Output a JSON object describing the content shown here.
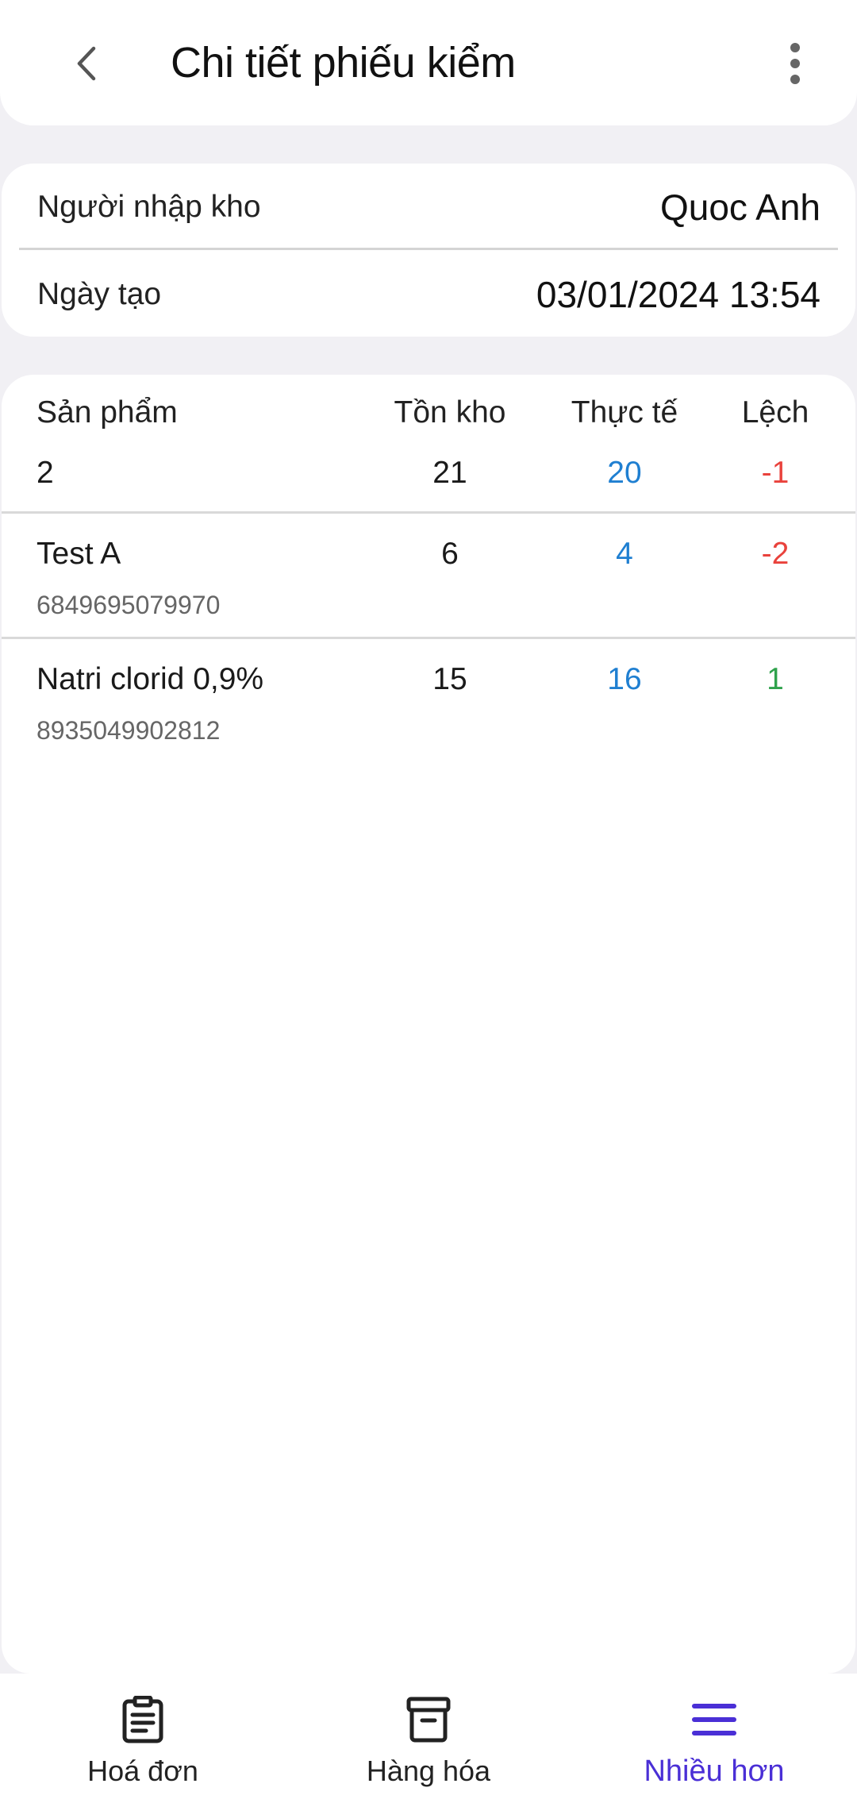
{
  "header": {
    "title": "Chi tiết phiếu kiểm",
    "back_icon": "chevron-left-icon",
    "more_icon": "more-vertical-icon"
  },
  "info": {
    "creator_label": "Người nhập kho",
    "creator_value": "Quoc Anh",
    "date_label": "Ngày tạo",
    "date_value": "03/01/2024 13:54"
  },
  "table": {
    "columns": [
      "Sản phẩm",
      "Tồn kho",
      "Thực tế",
      "Lệch"
    ],
    "summary": {
      "count": "2",
      "stock": "21",
      "actual": "20",
      "diff": "-1"
    },
    "rows": [
      {
        "name": "Test A",
        "code": "6849695079970",
        "stock": "6",
        "actual": "4",
        "diff": "-2"
      },
      {
        "name": "Natri clorid 0,9%",
        "code": "8935049902812",
        "stock": "15",
        "actual": "16",
        "diff": "1"
      }
    ]
  },
  "colors": {
    "actual": "#1f7fd1",
    "negative": "#e9423c",
    "positive": "#2fa24c",
    "accent": "#4a2fd6"
  },
  "nav": {
    "items": [
      {
        "label": "Hoá đơn",
        "icon": "clipboard-icon"
      },
      {
        "label": "Hàng hóa",
        "icon": "archive-box-icon"
      },
      {
        "label": "Nhiều hơn",
        "icon": "menu-icon"
      }
    ],
    "active": "Nhiều hơn"
  }
}
